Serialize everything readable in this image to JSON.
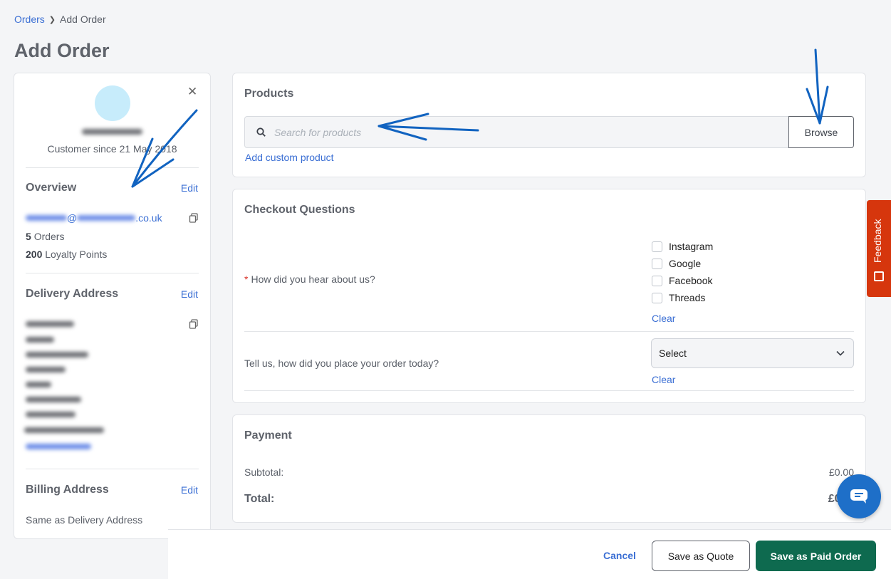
{
  "breadcrumb": {
    "parent": "Orders",
    "current": "Add Order"
  },
  "page": {
    "title": "Add Order"
  },
  "customer": {
    "since": "Customer since 21 May 2018",
    "overview_title": "Overview",
    "edit_label": "Edit",
    "email_at": "@",
    "email_suffix": ".co.uk",
    "orders_count": "5",
    "orders_label": "Orders",
    "points_count": "200",
    "points_label": "Loyalty Points",
    "delivery_title": "Delivery Address",
    "billing_title": "Billing Address",
    "billing_value": "Same as Delivery Address"
  },
  "products": {
    "title": "Products",
    "search_placeholder": "Search for products",
    "browse_label": "Browse",
    "add_custom_label": "Add custom product"
  },
  "checkout": {
    "title": "Checkout Questions",
    "q1": {
      "required_mark": "*",
      "label": "How did you hear about us?",
      "options": [
        "Instagram",
        "Google",
        "Facebook",
        "Threads"
      ],
      "clear_label": "Clear"
    },
    "q2": {
      "label": "Tell us, how did you place your order today?",
      "select_value": "Select",
      "clear_label": "Clear"
    }
  },
  "payment": {
    "title": "Payment",
    "subtotal_label": "Subtotal:",
    "subtotal_value": "£0.00",
    "total_label": "Total:",
    "total_value": "£0."
  },
  "footer": {
    "cancel_label": "Cancel",
    "quote_label": "Save as Quote",
    "paid_label": "Save as Paid Order"
  },
  "feedback": {
    "label": "Feedback"
  },
  "colors": {
    "accent": "#3b6fd4",
    "primary_button": "#0e6a4f",
    "feedback_tab": "#d6360d",
    "chat_launcher": "#1e6fc8",
    "annotation_arrow": "#1163c0"
  }
}
